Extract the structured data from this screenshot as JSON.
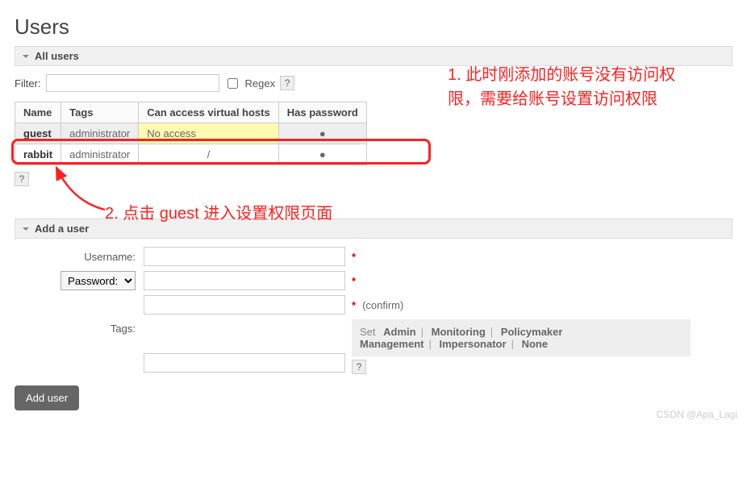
{
  "page_title": "Users",
  "sections": {
    "all_users": "All users",
    "add_user": "Add a user"
  },
  "filter": {
    "label": "Filter:",
    "value": "",
    "regex_label": "Regex",
    "help": "?"
  },
  "table": {
    "headers": [
      "Name",
      "Tags",
      "Can access virtual hosts",
      "Has password"
    ],
    "rows": [
      {
        "name": "guest",
        "tags": "administrator",
        "vhosts": "No access",
        "password": "●",
        "no_access": true,
        "highlight": true
      },
      {
        "name": "rabbit",
        "tags": "administrator",
        "vhosts": "/",
        "password": "●",
        "no_access": false,
        "highlight": false
      }
    ],
    "below_help": "?"
  },
  "annotations": {
    "a1": "1. 此时刚添加的账号没有访问权限，需要给账号设置访问权限",
    "a2": "2. 点击 guest 进入设置权限页面"
  },
  "add_user": {
    "username_label": "Username:",
    "username_value": "",
    "password_select": "Password:",
    "password_value": "",
    "confirm_value": "",
    "confirm_label": "(confirm)",
    "tags_label": "Tags:",
    "tags_value": "",
    "tag_set_label": "Set",
    "tag_options": [
      "Admin",
      "Monitoring",
      "Policymaker",
      "Management",
      "Impersonator",
      "None"
    ],
    "tag_help": "?",
    "button": "Add user"
  },
  "watermark": "CSDN @Apa_Lagi"
}
